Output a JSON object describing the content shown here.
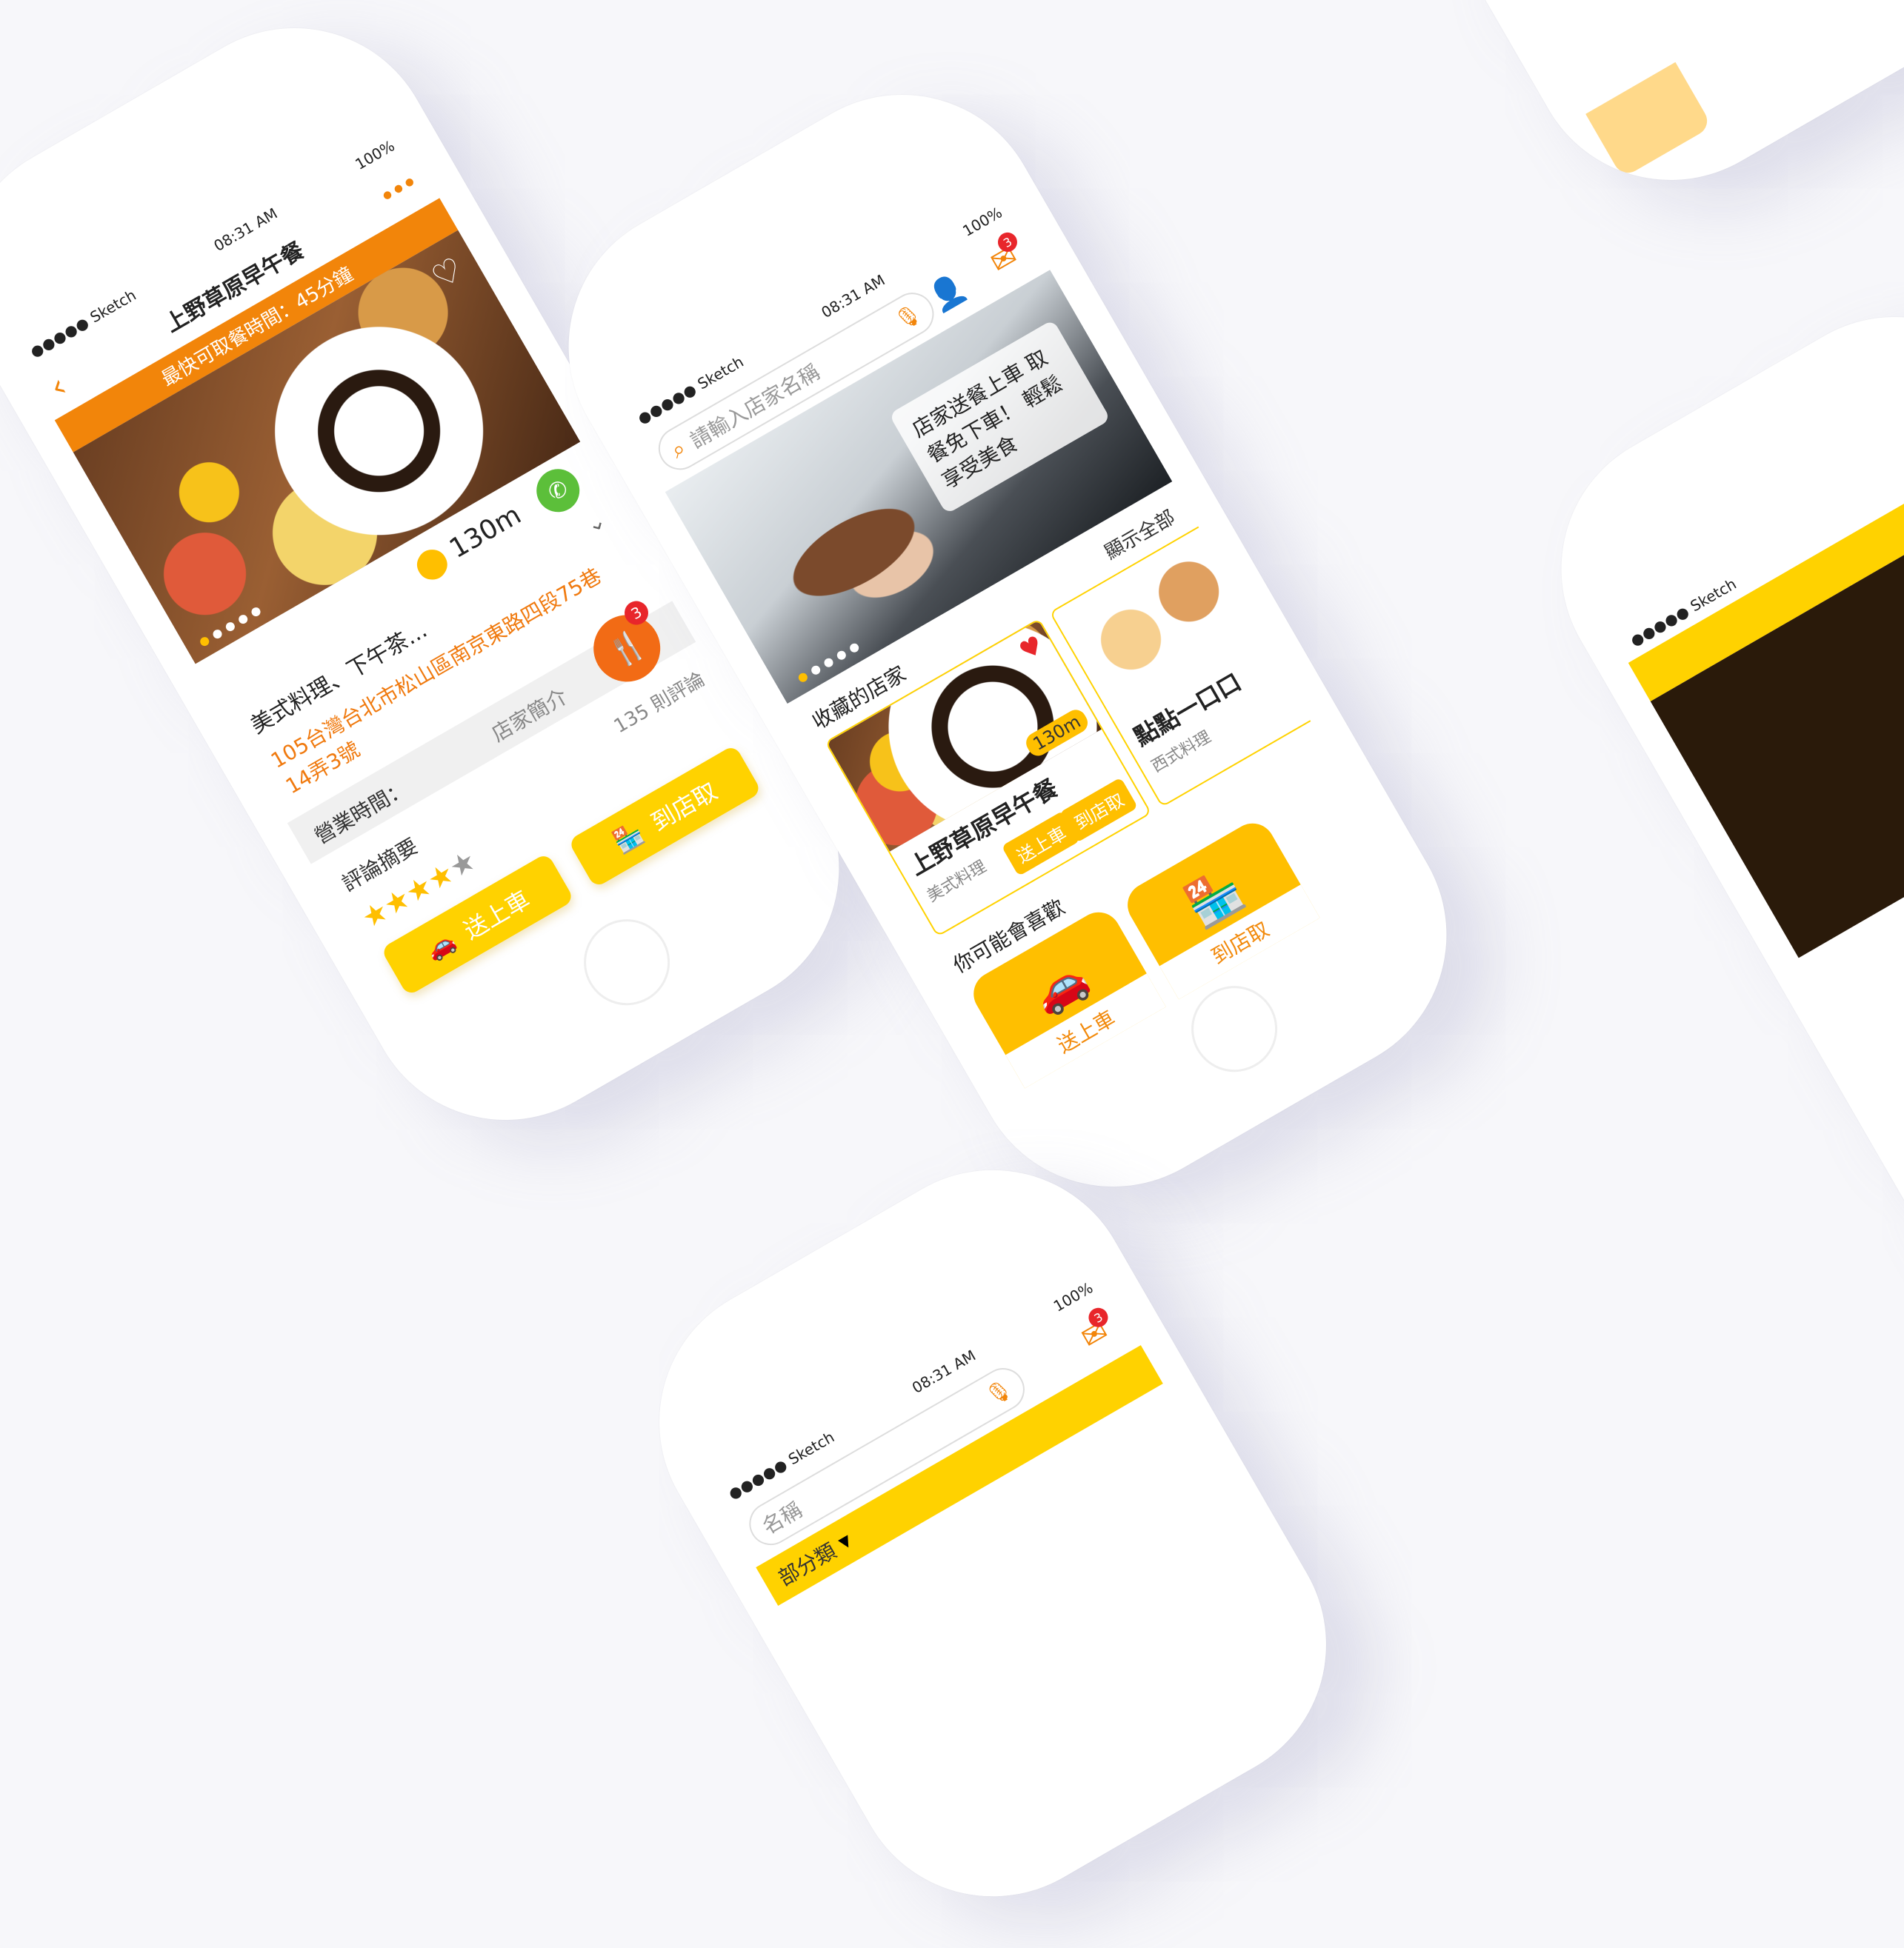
{
  "colors": {
    "accent_orange": "#f2850a",
    "accent_yellow": "#ffd200",
    "tile_yellow": "#ffbf00",
    "text_orange": "#f07a0f"
  },
  "status": {
    "carrier": "●●●●● Sketch",
    "time": "08:31 AM",
    "battery": "100%"
  },
  "phone1": {
    "title": "上野草原早午餐",
    "banner": "最快可取餐時間：45分鐘",
    "distance": "130m",
    "category": "美式料理、下午茶...",
    "address": "105台灣台北市松山區南京東路四段75巷14弄3號",
    "hours_label": "營業時間：",
    "intro_tab": "店家簡介",
    "review_summary": "評論摘要",
    "review_count": "135 則評論",
    "rating": "4 of 5",
    "badge_count": "3",
    "btn_delivery": "送上車",
    "btn_pickup": "到店取",
    "icons": {
      "back": "back-chevron-icon",
      "more": "more-dots-icon",
      "phone": "phone-icon",
      "pin": "location-pin-icon",
      "heart": "heart-icon",
      "utensils": "utensils-icon",
      "car": "car-icon",
      "store": "store-icon"
    }
  },
  "phone2": {
    "search_placeholder": "請輸入店家名稱",
    "banner_text": "店家送餐上車 取餐免下車！ 輕鬆享受美食",
    "favorites_title": "收藏的店家",
    "show_all": "顯示全部",
    "card1_name": "上野草原早午餐",
    "card1_category": "美式料理",
    "card1_distance": "130m",
    "card2_name": "點點一口口",
    "card2_category": "西式料理",
    "chip_delivery": "送上車",
    "chip_pickup": "到店取",
    "mail_badge": "3",
    "you_may_like": "你可能會喜歡",
    "tile_delivery": "送上車",
    "tile_pickup": "到店取"
  },
  "phone3": {
    "search_placeholder": "名稱",
    "category_label": "部分類",
    "mail_badge": "3"
  }
}
